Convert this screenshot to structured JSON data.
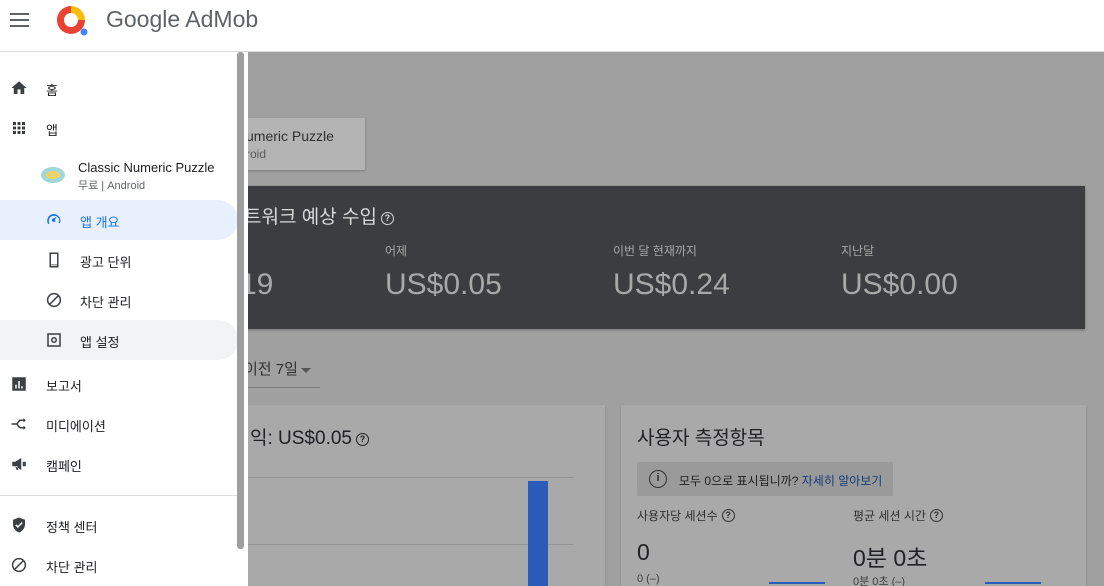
{
  "header": {
    "brand": "Google AdMob"
  },
  "sidebar": {
    "items": [
      {
        "label": "홈",
        "icon": "home-icon"
      },
      {
        "label": "앱",
        "icon": "apps-grid-icon"
      },
      {
        "label": "보고서",
        "icon": "bar-chart-icon"
      },
      {
        "label": "미디에이션",
        "icon": "mediation-icon"
      },
      {
        "label": "캠페인",
        "icon": "megaphone-icon"
      },
      {
        "label": "정책 센터",
        "icon": "shield-check-icon"
      },
      {
        "label": "차단 관리",
        "icon": "block-icon"
      }
    ],
    "app": {
      "name": "Classic Numeric Puzzle",
      "platform": "무료 | Android"
    },
    "sub_items": [
      {
        "label": "앱 개요",
        "icon": "gauge-icon",
        "state": "active"
      },
      {
        "label": "광고 단위",
        "icon": "ad-unit-icon"
      },
      {
        "label": "차단 관리",
        "icon": "block-icon"
      },
      {
        "label": "앱 설정",
        "icon": "settings-box-icon",
        "state": "hover"
      }
    ]
  },
  "main": {
    "app_chip": {
      "name": "umeric Puzzle",
      "platform": "roid"
    },
    "network_card": {
      "title": "트워크 예상 수입",
      "stats": [
        {
          "label": "",
          "value": "19"
        },
        {
          "label": "어제",
          "value": "US$0.05"
        },
        {
          "label": "이번 달 현재까지",
          "value": "US$0.24"
        },
        {
          "label": "지난달",
          "value": "US$0.00"
        }
      ]
    },
    "period": "이전 7일",
    "revenue_card": {
      "title": "익: US$0.05"
    },
    "user_card": {
      "title": "사용자 측정항목",
      "info_text": "모두 0으로 표시됩니까?",
      "info_link": "자세히 알아보기",
      "metrics": [
        {
          "label": "사용자당 세션수",
          "value": "0",
          "sub": "0 (–)"
        },
        {
          "label": "평균 세션 시간",
          "value": "0분 0초",
          "sub": "0분 0초 (–)"
        }
      ]
    }
  },
  "colors": {
    "accent": "#1a73e8",
    "active_bg": "#e8f0fe",
    "dark_card": "#3c3d40",
    "bar": "#2a5bb8"
  }
}
